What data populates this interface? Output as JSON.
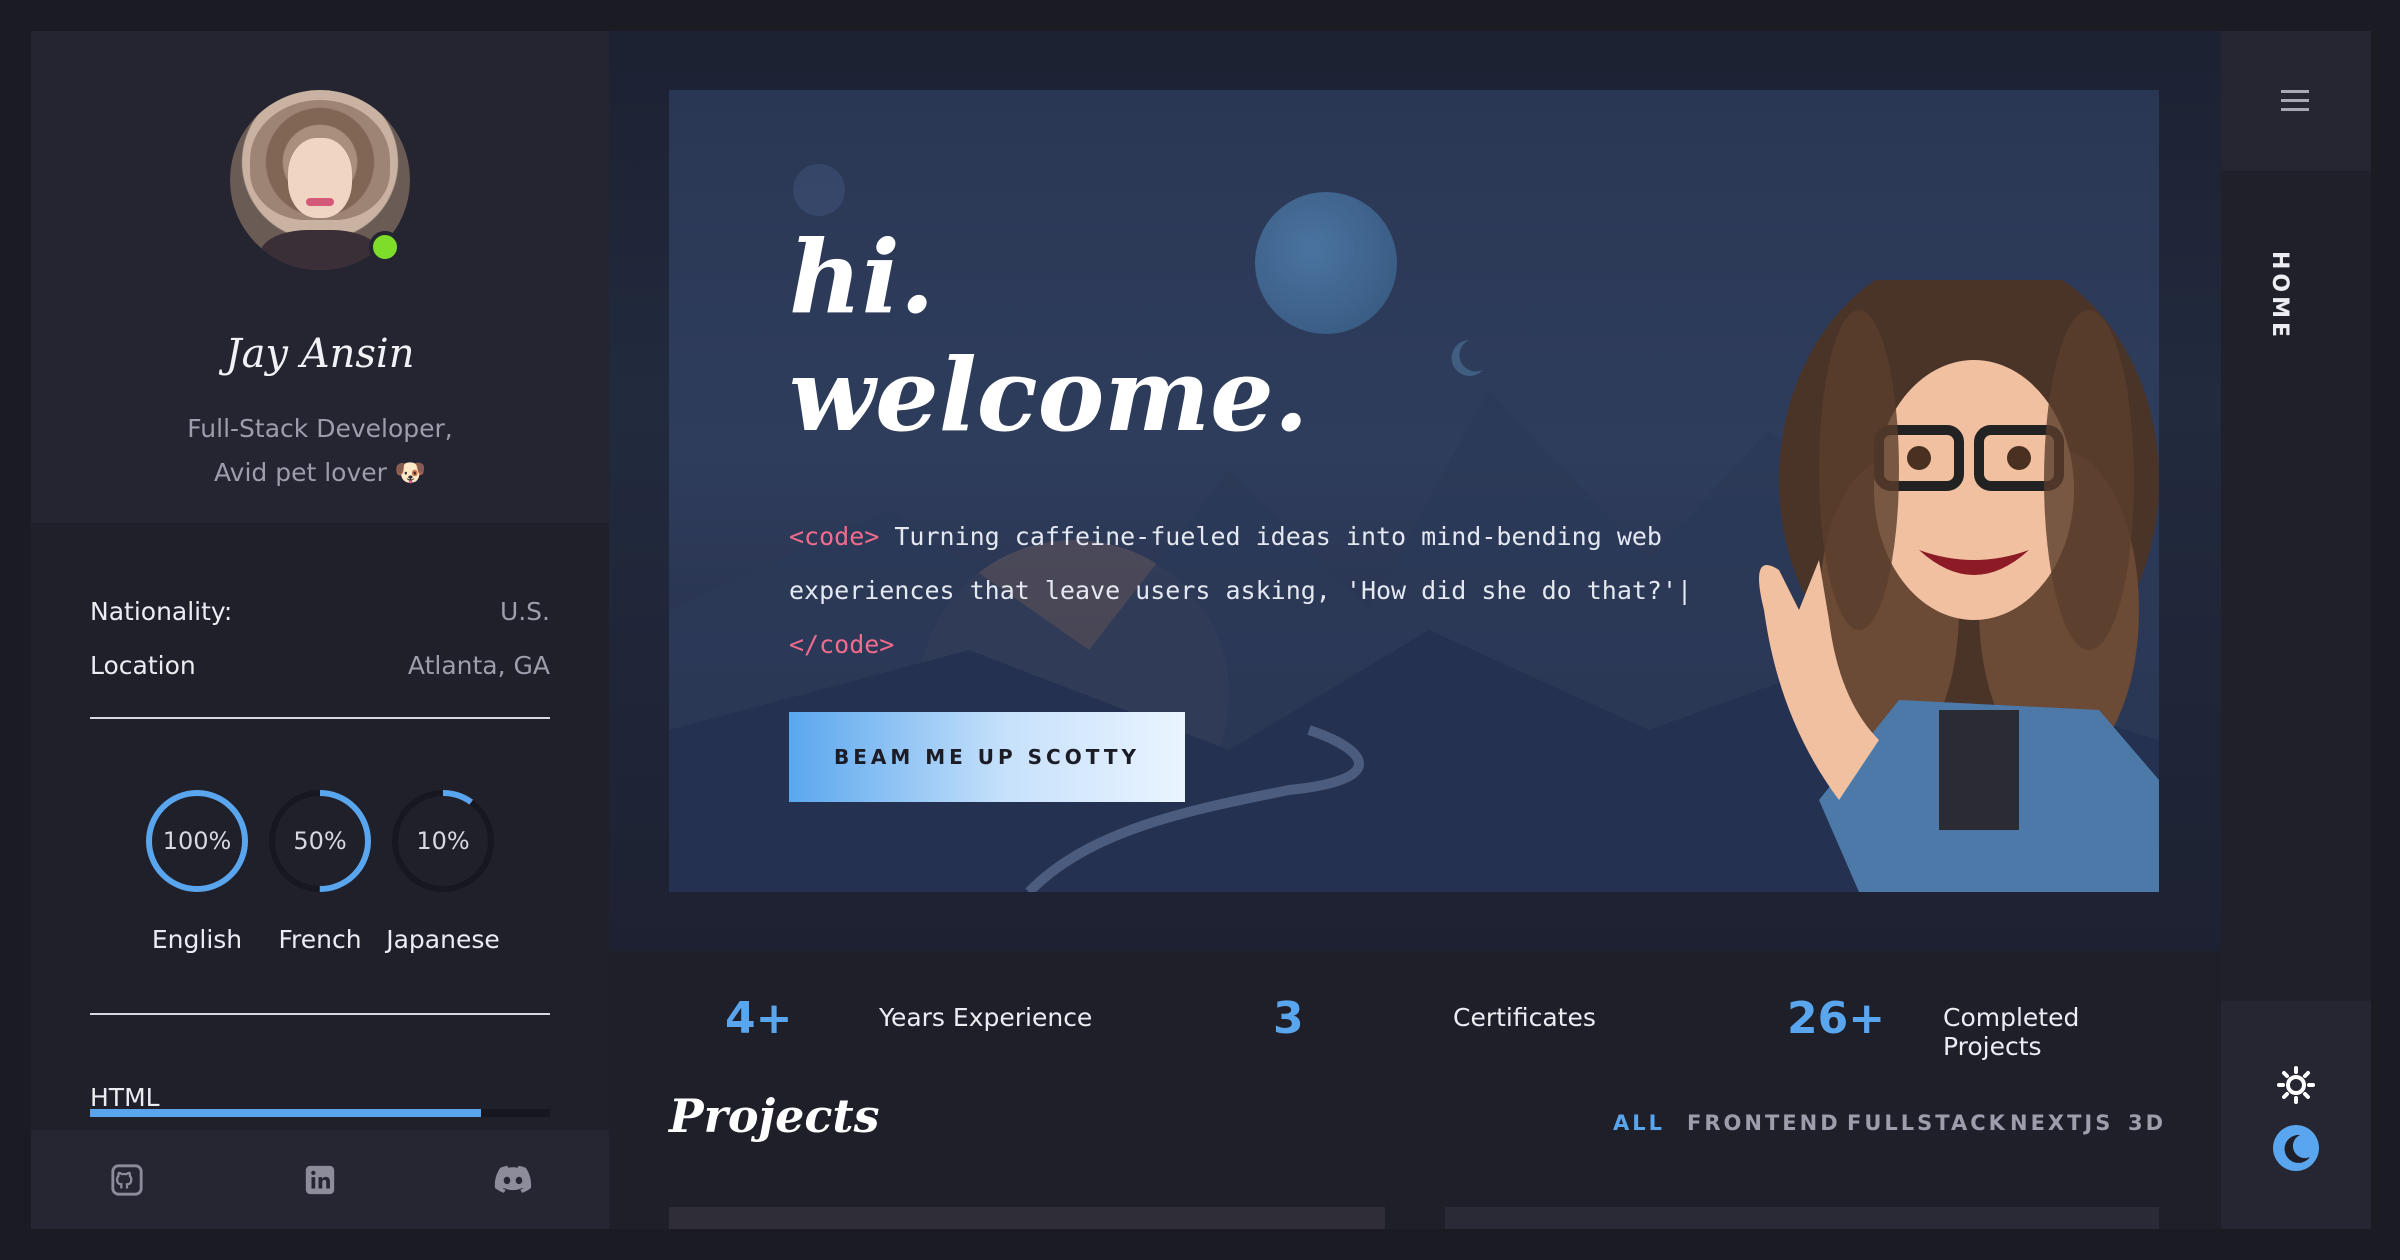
{
  "profile": {
    "name": "Jay Ansin",
    "role_line1": "Full-Stack Developer,",
    "role_line2": "Avid pet lover 🐶"
  },
  "info": [
    {
      "key": "Nationality:",
      "value": "U.S."
    },
    {
      "key": "Location",
      "value": "Atlanta, GA"
    }
  ],
  "languages": [
    {
      "label": "English",
      "percent_text": "100%",
      "level": 1.0
    },
    {
      "label": "French",
      "percent_text": "50%",
      "level": 0.5
    },
    {
      "label": "Japanese",
      "percent_text": "10%",
      "level": 0.1
    }
  ],
  "skills": [
    {
      "label": "HTML",
      "level": 0.85
    }
  ],
  "socials": [
    "github-icon",
    "linkedin-icon",
    "discord-icon"
  ],
  "hero": {
    "line1": "hi.",
    "line2": "welcome.",
    "code_open": "<code>",
    "code_body": " Turning caffeine-fueled ideas into mind-bending web experiences that leave users asking, 'How did she do that?'| ",
    "code_close": "</code>",
    "cta": "BEAM ME UP SCOTTY"
  },
  "stats": [
    {
      "number": "4+",
      "label": "Years Experience"
    },
    {
      "number": "3",
      "label": "Certificates"
    },
    {
      "number": "26+",
      "label": "Completed Projects"
    }
  ],
  "projects": {
    "title": "Projects",
    "filters": [
      "ALL",
      "FRONTEND",
      "FULLSTACK",
      "NEXTJS",
      "3D"
    ],
    "active_filter": "ALL"
  },
  "rail": {
    "menu_icon": "hamburger-icon",
    "current_page": "HOME",
    "theme_icons": [
      "sun-icon",
      "moon-icon"
    ]
  },
  "colors": {
    "accent": "#5aa6ee",
    "online": "#7edc2a",
    "code_keyword": "#f06b8c",
    "background": "#1f1f29"
  }
}
